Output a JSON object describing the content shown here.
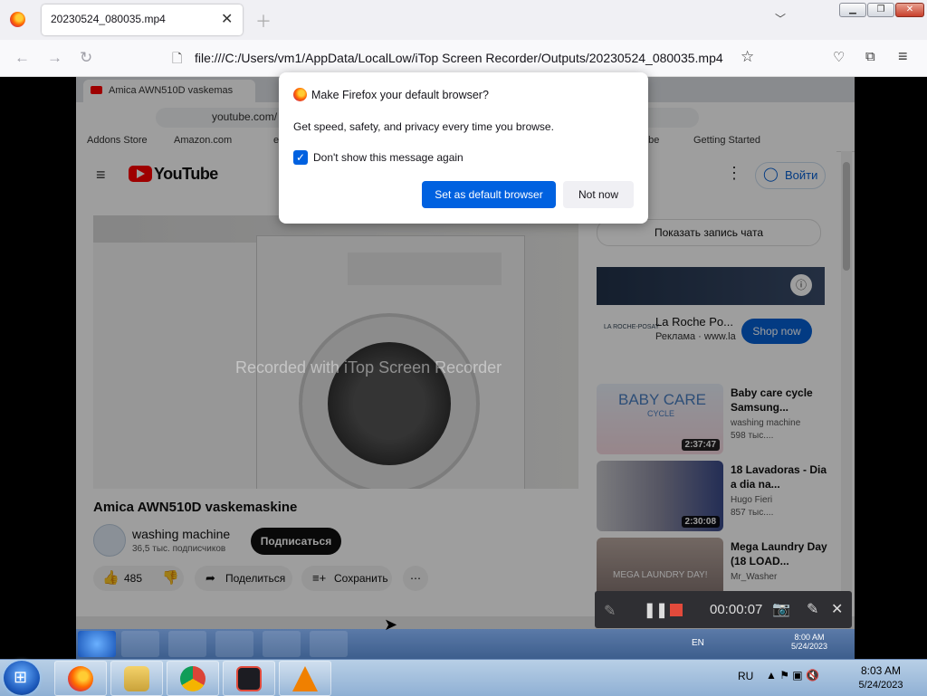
{
  "firefox": {
    "tab_title": "20230524_080035.mp4",
    "url": "file:///C:/Users/vm1/AppData/LocalLow/iTop Screen Recorder/Outputs/20230524_080035.mp4"
  },
  "dialog": {
    "title": "Make Firefox your default browser?",
    "body": "Get speed, safety, and privacy every time you browse.",
    "checkbox_label": "Don't show this message again",
    "checkbox_checked": true,
    "primary_button": "Set as default browser",
    "secondary_button": "Not now"
  },
  "video": {
    "watermark": "Recorded with iTop Screen Recorder",
    "chrome_tab_title": "Amica AWN510D vaskemas",
    "chrome_url": "youtube.com/",
    "bookmarks": [
      "Addons Store",
      "Amazon.com",
      "e",
      "ube",
      "Getting Started"
    ],
    "youtube": {
      "logo_text": "YouTube",
      "login": "Войти",
      "video_title": "Amica AWN510D vaskemaskine",
      "channel_name": "washing machine",
      "subscribers": "36,5 тыс. подписчиков",
      "subscribe": "Подписаться",
      "likes": "485",
      "share": "Поделиться",
      "save": "Сохранить",
      "chat_button": "Показать запись чата",
      "ad_title": "La Roche Po...",
      "ad_label": "Реклама · www.la",
      "shop_now": "Shop now",
      "recommendations": [
        {
          "title": "Baby care cycle Samsung...",
          "channel": "washing machine",
          "views": "598 тыс....",
          "duration": "2:37:47",
          "thumb_text": "BABY CARE",
          "thumb_sub": "CYCLE"
        },
        {
          "title": "18 Lavadoras - Dia a dia na...",
          "channel": "Hugo Fieri",
          "views": "857 тыс....",
          "duration": "2:30:08",
          "thumb_text": "",
          "thumb_sub": ""
        },
        {
          "title": "Mega Laundry Day (18 LOAD...",
          "channel": "Mr_Washer",
          "views": "",
          "duration": "",
          "thumb_text": "MEGA LAUNDRY DAY!",
          "thumb_sub": ""
        }
      ]
    },
    "inner_taskbar": {
      "lang": "EN",
      "time": "8:00 AM",
      "date": "5/24/2023"
    }
  },
  "recorder": {
    "timer": "00:00:07"
  },
  "taskbar": {
    "lang": "RU",
    "time": "8:03 AM",
    "date": "5/24/2023"
  }
}
